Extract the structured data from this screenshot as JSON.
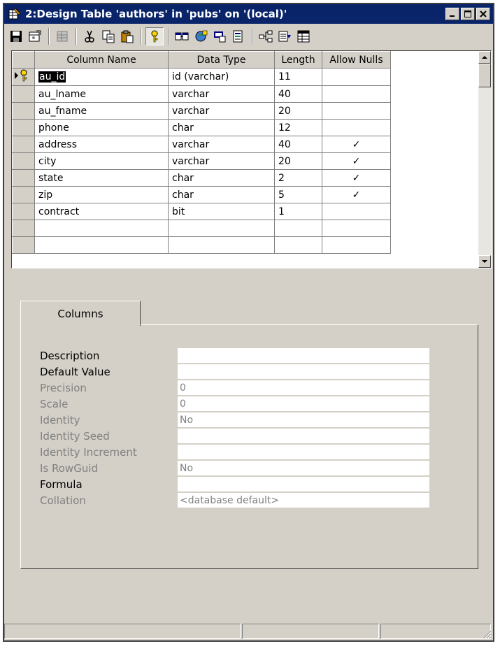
{
  "window": {
    "title": "2:Design Table 'authors' in 'pubs' on '(local)'",
    "controls": [
      "minimize-icon",
      "maximize-icon",
      "close-icon"
    ]
  },
  "toolbar": {
    "buttons": [
      "save-icon",
      "table-properties-icon",
      "insert-column-icon",
      "cut-icon",
      "copy-icon",
      "paste-icon",
      "primary-key-icon",
      "manage-relationships-icon",
      "manage-indexes-icon",
      "manage-constraints-icon",
      "manage-triggers-icon",
      "diagram-icon",
      "show-columns-icon",
      "grid-icon"
    ]
  },
  "grid": {
    "headers": [
      "Column Name",
      "Data Type",
      "Length",
      "Allow Nulls"
    ],
    "rows": [
      {
        "name": "au_id",
        "type": "id (varchar)",
        "length": "11",
        "nulls": "",
        "key": true
      },
      {
        "name": "au_lname",
        "type": "varchar",
        "length": "40",
        "nulls": ""
      },
      {
        "name": "au_fname",
        "type": "varchar",
        "length": "20",
        "nulls": ""
      },
      {
        "name": "phone",
        "type": "char",
        "length": "12",
        "nulls": ""
      },
      {
        "name": "address",
        "type": "varchar",
        "length": "40",
        "nulls": "✓"
      },
      {
        "name": "city",
        "type": "varchar",
        "length": "20",
        "nulls": "✓"
      },
      {
        "name": "state",
        "type": "char",
        "length": "2",
        "nulls": "✓"
      },
      {
        "name": "zip",
        "type": "char",
        "length": "5",
        "nulls": "✓"
      },
      {
        "name": "contract",
        "type": "bit",
        "length": "1",
        "nulls": ""
      },
      {
        "name": "",
        "type": "",
        "length": "",
        "nulls": ""
      },
      {
        "name": "",
        "type": "",
        "length": "",
        "nulls": ""
      }
    ]
  },
  "tabs": {
    "columns_label": "Columns"
  },
  "properties": [
    {
      "label": "Description",
      "value": "",
      "enabled": true
    },
    {
      "label": "Default Value",
      "value": "",
      "enabled": true
    },
    {
      "label": "Precision",
      "value": "0",
      "enabled": false
    },
    {
      "label": "Scale",
      "value": "0",
      "enabled": false
    },
    {
      "label": "Identity",
      "value": "No",
      "enabled": false
    },
    {
      "label": "Identity Seed",
      "value": "",
      "enabled": false
    },
    {
      "label": "Identity Increment",
      "value": "",
      "enabled": false
    },
    {
      "label": "Is RowGuid",
      "value": "No",
      "enabled": false
    },
    {
      "label": "Formula",
      "value": "",
      "enabled": true
    },
    {
      "label": "Collation",
      "value": "<database default>",
      "enabled": false
    }
  ],
  "colors": {
    "title_bar": "#0a246a",
    "face": "#d4d0c8",
    "disabled_text": "#808080"
  }
}
